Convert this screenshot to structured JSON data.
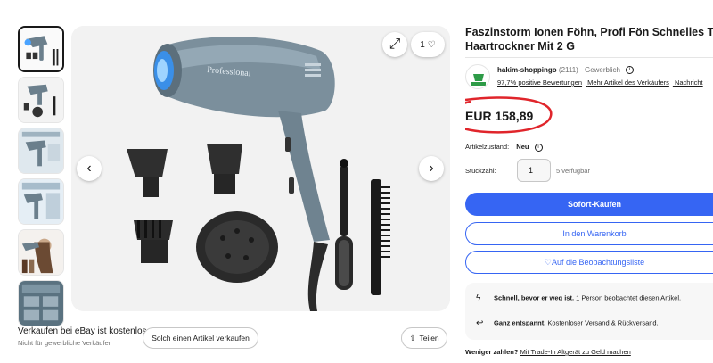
{
  "gallery": {
    "watch_count": "1",
    "share_label": "Teilen"
  },
  "sell": {
    "title": "Verkaufen bei eBay ist kostenlos",
    "subtitle": "Nicht für gewerbliche Verkäufer",
    "button_label": "Solch einen Artikel verkaufen"
  },
  "product": {
    "title_line1": "Faszinstorm Ionen Föhn, Profi Fön Schnelles Trocknen",
    "title_line2": "Haartrockner Mit 2 G",
    "brand_text": "Professional"
  },
  "seller": {
    "name": "hakim-shoppingo",
    "rating_count": "(2111)",
    "type": "· Gewerblich",
    "positive": "97,7% positive Bewertungen",
    "more_items": "Mehr Artikel des Verkäufers",
    "contact": "Nachricht"
  },
  "price": {
    "value": "EUR 158,89"
  },
  "condition": {
    "label": "Artikelzustand:",
    "value": "Neu"
  },
  "quantity": {
    "label": "Stückzahl:",
    "value": "1",
    "available": "5 verfügbar"
  },
  "actions": {
    "buy_now": "Sofort-Kaufen",
    "add_to_cart": "In den Warenkorb",
    "watch": "Auf die Beobachtungsliste"
  },
  "promos": [
    {
      "bold": "Schnell, bevor er weg ist.",
      "text": " 1 Person beobachtet diesen Artikel."
    },
    {
      "bold": "Ganz entspannt.",
      "text": " Kostenloser Versand & Rückversand."
    }
  ],
  "trade_in": {
    "bold": "Weniger zahlen?",
    "link": "Mit Trade-In Altgerät zu Geld machen"
  },
  "colors": {
    "primary_blue": "#3665f3",
    "annotation_red": "#e0252b"
  }
}
